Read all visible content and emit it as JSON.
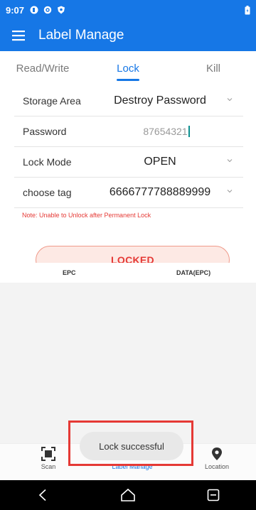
{
  "status_bar": {
    "time": "9:07",
    "icons": [
      "app-icon",
      "settings-icon",
      "shield-icon",
      "battery-icon"
    ]
  },
  "app_bar": {
    "menu_icon": "menu-icon",
    "title": "Label Manage"
  },
  "tabs": [
    {
      "label": "Read/Write",
      "active": false
    },
    {
      "label": "Lock",
      "active": true
    },
    {
      "label": "Kill",
      "active": false
    }
  ],
  "form": {
    "storage_area": {
      "label": "Storage Area",
      "value": "Destroy Password"
    },
    "password": {
      "label": "Password",
      "value": "87654321"
    },
    "lock_mode": {
      "label": "Lock Mode",
      "value": "OPEN"
    },
    "choose_tag": {
      "label": "choose tag",
      "value": "6666777788889999"
    }
  },
  "note": "Note: Unable to Unlock after Permanent Lock",
  "action_button": "LOCKED",
  "table": {
    "col1": "EPC",
    "col2": "DATA(EPC)"
  },
  "toast": "Lock successful",
  "bottom_nav": [
    {
      "label": "Scan",
      "icon": "scan-icon",
      "active": false
    },
    {
      "label": "Label Manage",
      "icon": "tag-icon",
      "active": true
    },
    {
      "label": "Location",
      "icon": "location-pin-icon",
      "active": false
    }
  ],
  "colors": {
    "primary": "#1677e6",
    "danger": "#e53935",
    "button_bg": "#fde9e4"
  }
}
